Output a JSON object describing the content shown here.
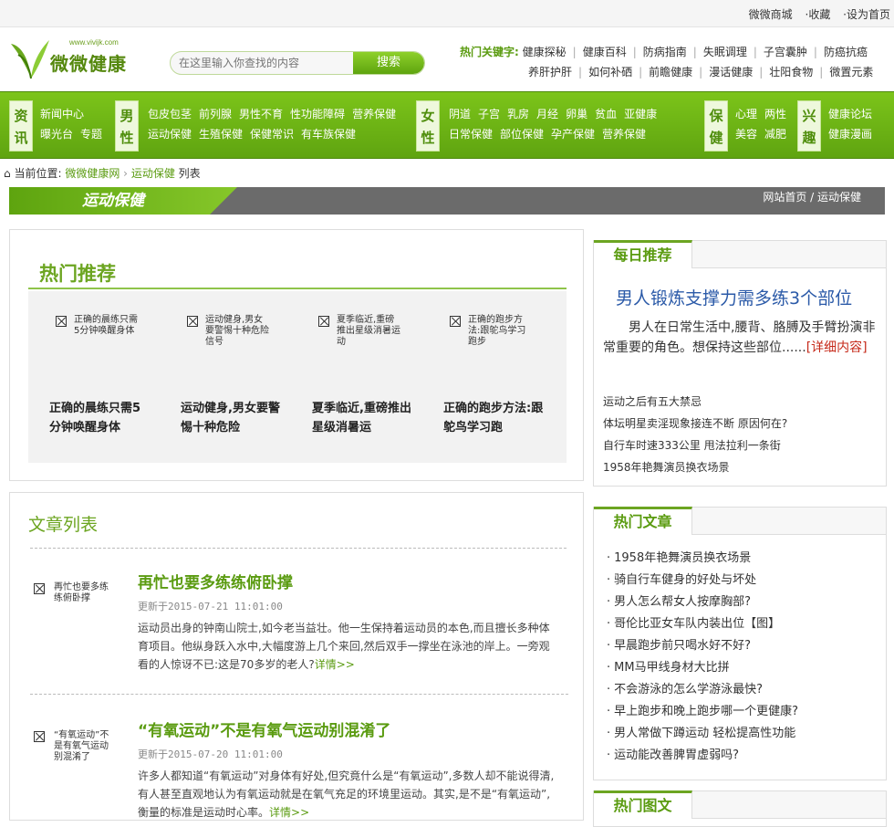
{
  "topbar": {
    "links": [
      "微微商城",
      "·收藏",
      "·设为首页"
    ]
  },
  "logo": {
    "url": "www.vivijk.com",
    "name": "微微健康"
  },
  "search": {
    "placeholder": "在这里输入你查找的内容",
    "button": "搜索"
  },
  "hot_keywords": {
    "label": "热门关键字:",
    "row1": [
      "健康探秘",
      "健康百科",
      "防病指南",
      "失眠调理",
      "子宫囊肿",
      "防癌抗癌"
    ],
    "row2": [
      "养肝护肝",
      "如何补硒",
      "前瞻健康",
      "漫话健康",
      "壮阳食物",
      "微置元素"
    ]
  },
  "nav": [
    {
      "cat": [
        "资",
        "讯"
      ],
      "row1": [
        "新闻中心"
      ],
      "row2": [
        "曝光台",
        "专题"
      ]
    },
    {
      "cat": [
        "男",
        "性"
      ],
      "row1": [
        "包皮包茎",
        "前列腺",
        "男性不育",
        "性功能障碍",
        "营养保健"
      ],
      "row2": [
        "运动保健",
        "生殖保健",
        "保健常识",
        "有车族保健"
      ]
    },
    {
      "cat": [
        "女",
        "性"
      ],
      "row1": [
        "阴道",
        "子宫",
        "乳房",
        "月经",
        "卵巢",
        "贫血",
        "亚健康"
      ],
      "row2": [
        "日常保健",
        "部位保健",
        "孕产保健",
        "营养保健"
      ]
    },
    {
      "cat": [
        "保",
        "健"
      ],
      "row1": [
        "心理",
        "两性"
      ],
      "row2": [
        "美容",
        "减肥"
      ]
    },
    {
      "cat": [
        "兴",
        "趣"
      ],
      "row1": [
        "健康论坛"
      ],
      "row2": [
        "健康漫画"
      ]
    }
  ],
  "breadcrumb": {
    "prefix": "当前位置:",
    "home": "微微健康网",
    "section": "运动保健",
    "page": "列表"
  },
  "title_bar": {
    "title": "运动保健",
    "right": "网站首页 / 运动保健"
  },
  "hot_recommend": {
    "title": "热门推荐",
    "items": [
      {
        "alt": "正确的晨练只需5分钟唤醒身体",
        "title": "正确的晨练只需5分钟唤醒身体"
      },
      {
        "alt": "运动健身,男女要警惕十种危险信号",
        "title": "运动健身,男女要警惕十种危险"
      },
      {
        "alt": "夏季临近,重磅推出星级消暑运动",
        "title": "夏季临近,重磅推出星级消暑运"
      },
      {
        "alt": "正确的跑步方法:跟鸵鸟学习跑步",
        "title": "正确的跑步方法:跟鸵鸟学习跑"
      }
    ]
  },
  "article_list": {
    "title": "文章列表",
    "items": [
      {
        "alt": "再忙也要多练练俯卧撑",
        "title": "再忙也要多练练俯卧撑",
        "date": "更新于2015-07-21 11:01:00",
        "desc": "运动员出身的钟南山院士,如今老当益壮。他一生保持着运动员的本色,而且擅长多种体育项目。他纵身跃入水中,大幅度游上几个来回,然后双手一撑坐在泳池的岸上。一旁观看的人惊讶不已:这是70多岁的老人?",
        "more": "详情>>"
      },
      {
        "alt": "“有氧运动”不是有氧气运动别混淆了",
        "title": "“有氧运动”不是有氧气运动别混淆了",
        "date": "更新于2015-07-20 11:01:00",
        "desc": "许多人都知道“有氧运动”对身体有好处,但究竟什么是“有氧运动”,多数人却不能说得清,有人甚至直观地认为有氧运动就是在氧气充足的环境里运动。其实,是不是“有氧运动”,衡量的标准是运动时心率。",
        "more": "详情>>"
      }
    ]
  },
  "daily": {
    "title": "每日推荐",
    "headline": "男人锻炼支撑力需多练3个部位",
    "desc": "男人在日常生活中,腰背、胳膊及手臂扮演非常重要的角色。想保持这些部位......",
    "more": "[详细内容]",
    "links": [
      "运动之后有五大禁忌",
      "体坛明星卖淫现象接连不断 原因何在?",
      "自行车时速333公里 甩法拉利一条街",
      "1958年艳舞演员换衣场景"
    ]
  },
  "hot_articles": {
    "title": "热门文章",
    "items": [
      "1958年艳舞演员换衣场景",
      "骑自行车健身的好处与坏处",
      "男人怎么帮女人按摩胸部?",
      "哥伦比亚女车队内装出位【图】",
      "早晨跑步前只喝水好不好?",
      "MM马甲线身材大比拼",
      "不会游泳的怎么学游泳最快?",
      "早上跑步和晚上跑步哪一个更健康?",
      "男人常做下蹲运动 轻松提高性功能",
      "运动能改善脾胃虚弱吗?"
    ]
  },
  "hot_pics": {
    "title": "热门图文"
  },
  "colors": {
    "accent": "#5a9b10",
    "nav_green": "#6cb516",
    "link_blue": "#2b5aa8",
    "more_red": "#c62a1a"
  }
}
